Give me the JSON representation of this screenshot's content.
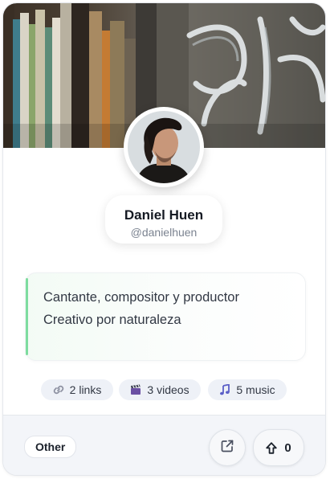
{
  "profile": {
    "name": "Daniel Huen",
    "handle": "@danielhuen",
    "bio_lines": [
      "Cantante, compositor y productor",
      "Creativo por naturaleza"
    ]
  },
  "stats": [
    {
      "icon": "link-icon",
      "label": "2 links"
    },
    {
      "icon": "clapperboard-icon",
      "label": "3 videos"
    },
    {
      "icon": "music-note-icon",
      "label": "5 music"
    }
  ],
  "footer": {
    "category": "Other",
    "share_icon": "external-link-icon",
    "upvote_icon": "arrow-up-icon",
    "upvote_count": "0"
  },
  "colors": {
    "bio_accent": "#7edc9f",
    "stat_pill_bg": "#eef1f7",
    "footer_bg": "#f3f5f9"
  }
}
